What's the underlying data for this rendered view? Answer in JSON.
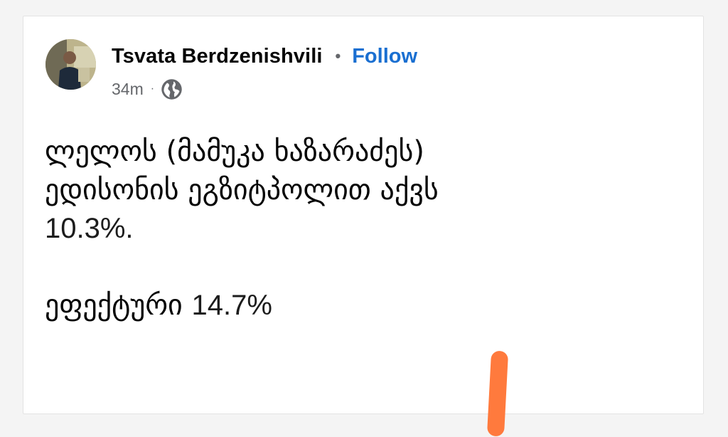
{
  "post": {
    "author": "Tsvata Berdzenishvili",
    "separator": "•",
    "follow_label": "Follow",
    "time": "34m",
    "meta_separator": "·",
    "audience_icon": "globe-icon",
    "lines": {
      "line1": "ლელოს (მამუკა ხაზარაძეს)",
      "line2": "ედისონის ეგზიტპოლით აქვს",
      "line3": "10.3%.",
      "line4_word": "ეფექტური",
      "line4_value": "14.7%"
    }
  },
  "colors": {
    "link": "#1a6fd1",
    "secondary_text": "#65676b",
    "annotation_mark": "#ff7a3d"
  }
}
